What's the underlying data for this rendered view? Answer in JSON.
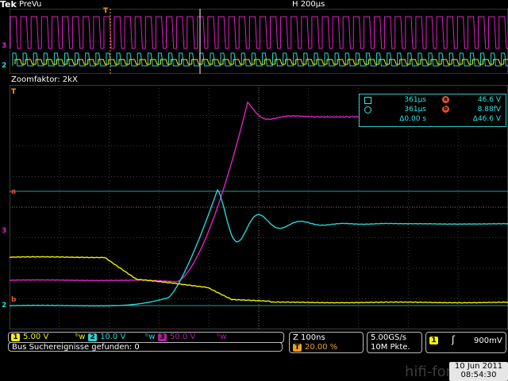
{
  "header": {
    "brand": "Tek",
    "mode": "PreVu",
    "horizontal": "H 200µs"
  },
  "zoom": {
    "label": "Zoomfaktor: 2kX"
  },
  "measurements": {
    "cursor1_time": "361µs",
    "cursor2_time": "361µs",
    "delta_time": "Δ0.00 s",
    "cursor_a_value": "46.6 V",
    "cursor_b_value": "8.88fV",
    "delta_value": "Δ46.6 V",
    "badge_a": "a",
    "badge_b": "b"
  },
  "channels": [
    {
      "num": "1",
      "scale": "5.00 V",
      "color": "#f2f200"
    },
    {
      "num": "2",
      "scale": "10.0 V",
      "color": "#22d8d8"
    },
    {
      "num": "3",
      "scale": "50.0 V",
      "color": "#e020c8"
    }
  ],
  "status": {
    "bus_message": "Bus Suchereignisse gefunden: 0",
    "zoom_time": "Z 100ns",
    "trigger_pos": "20.00 %",
    "sample_rate": "5.00GS/s",
    "record_length": "10M Pkte.",
    "trigger_channel": "1",
    "trigger_level": "900mV",
    "date": "10 Jun 2011",
    "time": "08:54:30"
  },
  "markers": {
    "trigger_T": "T",
    "ch3_marker": "3",
    "ch2_marker": "2",
    "cursor_a": "a",
    "cursor_b": "b"
  },
  "watermark": "hifi-forum.de",
  "colors": {
    "ch1": "#f2f200",
    "ch2": "#22d8d8",
    "ch3": "#e020c8",
    "cursor": "#e8502a",
    "grid": "#555"
  }
}
